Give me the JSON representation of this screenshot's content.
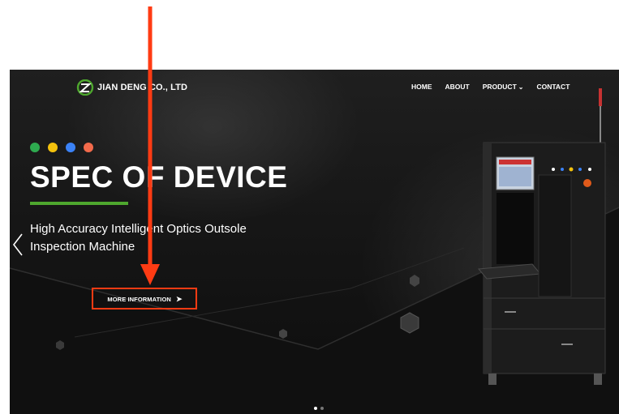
{
  "brand": {
    "name": "JIAN DENG CO., LTD",
    "logo_color": "#4ea72e"
  },
  "nav": {
    "items": [
      {
        "label": "HOME"
      },
      {
        "label": "ABOUT"
      },
      {
        "label": "PRODUCT",
        "has_dropdown": true,
        "caret": "⌄"
      },
      {
        "label": "CONTACT"
      }
    ]
  },
  "hero": {
    "indicator_dots": [
      "#2eaa4f",
      "#f4c20d",
      "#3b82f6",
      "#f26a4b"
    ],
    "title": "SPEC OF DEVICE",
    "title_underline_color": "#4ea72e",
    "subtitle_line1": "High Accuracy Intelligent Optics Outsole",
    "subtitle_line2": "Inspection Machine",
    "cta_label": "MORE INFORMATION",
    "cta_icon": "➤",
    "prev_icon": "chevron-left-icon",
    "slide_count": 2,
    "active_slide": 1
  },
  "annotation": {
    "color": "#ff3b13"
  }
}
